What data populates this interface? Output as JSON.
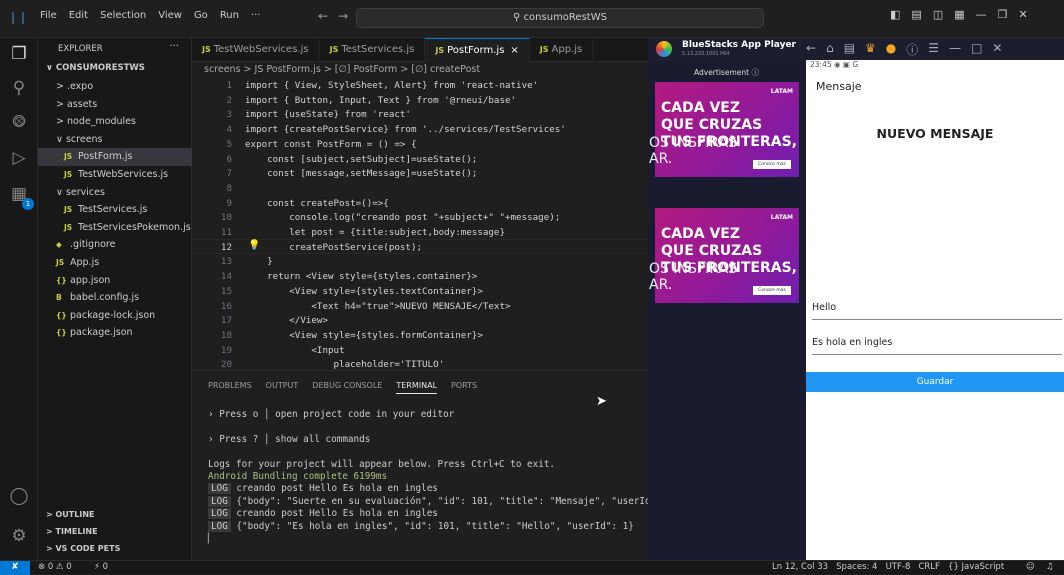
{
  "window": {
    "menu": [
      "File",
      "Edit",
      "Selection",
      "View",
      "Go",
      "Run",
      "···"
    ],
    "search": "consumoRestWS"
  },
  "explorer": {
    "header": "EXPLORER",
    "project": "CONSUMORESTWS",
    "items": [
      {
        "label": "> .expo",
        "icon": "",
        "depth": 1
      },
      {
        "label": "> assets",
        "icon": "",
        "depth": 1
      },
      {
        "label": "> node_modules",
        "icon": "",
        "depth": 1
      },
      {
        "label": "∨ screens",
        "icon": "",
        "depth": 1
      },
      {
        "label": "PostForm.js",
        "icon": "JS",
        "depth": 2,
        "selected": true
      },
      {
        "label": "TestWebServices.js",
        "icon": "JS",
        "depth": 2
      },
      {
        "label": "∨ services",
        "icon": "",
        "depth": 1
      },
      {
        "label": "TestServices.js",
        "icon": "JS",
        "depth": 2
      },
      {
        "label": "TestServicesPokemon.js",
        "icon": "JS",
        "depth": 2
      },
      {
        "label": ".gitignore",
        "icon": "◆",
        "depth": 1
      },
      {
        "label": "App.js",
        "icon": "JS",
        "depth": 1
      },
      {
        "label": "app.json",
        "icon": "{}",
        "depth": 1
      },
      {
        "label": "babel.config.js",
        "icon": "B",
        "depth": 1
      },
      {
        "label": "package-lock.json",
        "icon": "{}",
        "depth": 1
      },
      {
        "label": "package.json",
        "icon": "{}",
        "depth": 1
      }
    ],
    "sections": [
      "> OUTLINE",
      "> TIMELINE",
      "> VS CODE PETS"
    ]
  },
  "tabs": [
    {
      "label": "TestWebServices.js",
      "icon": "JS",
      "active": false
    },
    {
      "label": "TestServices.js",
      "icon": "JS",
      "active": false
    },
    {
      "label": "PostForm.js",
      "icon": "JS",
      "active": true,
      "close": "×"
    },
    {
      "label": "App.js",
      "icon": "JS",
      "active": false
    }
  ],
  "breadcrumb": "screens > JS PostForm.js > [∅] PostForm > [∅] createPost",
  "code": {
    "current_line": 12,
    "lines": [
      {
        "n": "1",
        "text": "import { View, StyleSheet, Alert} from 'react-native'",
        "color": "#d4d4d4"
      },
      {
        "n": "2",
        "text": "import { Button, Input, Text } from '@rneui/base'",
        "color": "#d4d4d4"
      },
      {
        "n": "3",
        "text": "import {useState} from 'react'",
        "color": "#d4d4d4"
      },
      {
        "n": "4",
        "text": "import {createPostService} from '../services/TestServices'",
        "color": "#d4d4d4"
      },
      {
        "n": "5",
        "text": "export const PostForm = () => {",
        "color": "#d4d4d4"
      },
      {
        "n": "6",
        "text": "    const [subject,setSubject]=useState();",
        "color": "#d4d4d4"
      },
      {
        "n": "7",
        "text": "    const [message,setMessage]=useState();",
        "color": "#d4d4d4"
      },
      {
        "n": "8",
        "text": "",
        "color": "#d4d4d4"
      },
      {
        "n": "9",
        "text": "    const createPost=()=>{",
        "color": "#d4d4d4"
      },
      {
        "n": "10",
        "text": "        console.log(\"creando post \"+subject+\" \"+message);",
        "color": "#d4d4d4"
      },
      {
        "n": "11",
        "text": "        let post = {title:subject,body:message}",
        "color": "#d4d4d4"
      },
      {
        "n": "12",
        "text": "        createPostService(post);",
        "color": "#d4d4d4"
      },
      {
        "n": "13",
        "text": "    }",
        "color": "#d4d4d4"
      },
      {
        "n": "14",
        "text": "    return <View style={styles.container}>",
        "color": "#d4d4d4"
      },
      {
        "n": "15",
        "text": "        <View style={styles.textContainer}>",
        "color": "#d4d4d4"
      },
      {
        "n": "16",
        "text": "            <Text h4=\"true\">NUEVO MENSAJE</Text>",
        "color": "#d4d4d4"
      },
      {
        "n": "17",
        "text": "        </View>",
        "color": "#d4d4d4"
      },
      {
        "n": "18",
        "text": "        <View style={styles.formContainer}>",
        "color": "#d4d4d4"
      },
      {
        "n": "19",
        "text": "            <Input",
        "color": "#d4d4d4"
      },
      {
        "n": "20",
        "text": "                placeholder='TITULO'",
        "color": "#d4d4d4"
      }
    ]
  },
  "panel": {
    "tabs": [
      "PROBLEMS",
      "OUTPUT",
      "DEBUG CONSOLE",
      "TERMINAL",
      "PORTS"
    ],
    "active_tab": "TERMINAL",
    "terminal": [
      {
        "text": "› Press o │ open project code in your editor",
        "log": false,
        "color": "#ccc"
      },
      {
        "text": "",
        "log": false,
        "color": "#ccc"
      },
      {
        "text": "› Press ? │ show all commands",
        "log": false,
        "color": "#ccc"
      },
      {
        "text": "",
        "log": false,
        "color": "#ccc"
      },
      {
        "text": "Logs for your project will appear below. Press Ctrl+C to exit.",
        "log": false,
        "color": "#ccc"
      },
      {
        "text": "Android Bundling complete 6199ms",
        "log": false,
        "color": "#ccc"
      },
      {
        "text": "creando post Hello Es hola en ingles",
        "log": true,
        "color": "#ccc"
      },
      {
        "text": "{\"body\": \"Suerte en su evaluación\", \"id\": 101, \"title\": \"Mensaje\", \"userId\"",
        "log": true,
        "color": "#ccc"
      },
      {
        "text": "creando post Hello Es hola en ingles",
        "log": true,
        "color": "#ccc"
      },
      {
        "text": "{\"body\": \"Es hola en ingles\", \"id\": 101, \"title\": \"Hello\", \"userId\": 1}",
        "log": true,
        "color": "#ccc"
      }
    ],
    "log_tag": "LOG"
  },
  "status": {
    "problems": "⊗ 0 ⚠ 0",
    "ports": "⚡ 0",
    "right": "Ln 12, Col 33   Spaces: 4   UTF-8   CRLF   {} JavaScript"
  },
  "bluestacks": {
    "name": "BlueStacks App Player",
    "version": "5.13.220.1001 P64",
    "ad_label": "Advertisement ⓘ",
    "ad_big": "CADA VEZ\nQUE CRUZAS\nTUS FRONTERAS,",
    "ad_thin": "OS INSPIRAS\nAR.",
    "ad_brand": "LATAM",
    "ad_button": "Conoce más"
  },
  "phone": {
    "status": "23:45 ◉ ▣ G",
    "header": "Mensaje",
    "title": "NUEVO MENSAJE",
    "subject_value": "Hello",
    "message_value": "Es hola en ingles",
    "button": "Guardar"
  },
  "colors": {
    "accent": "#0078d4",
    "button": "#2196f3",
    "ad": "#a61d8c"
  }
}
